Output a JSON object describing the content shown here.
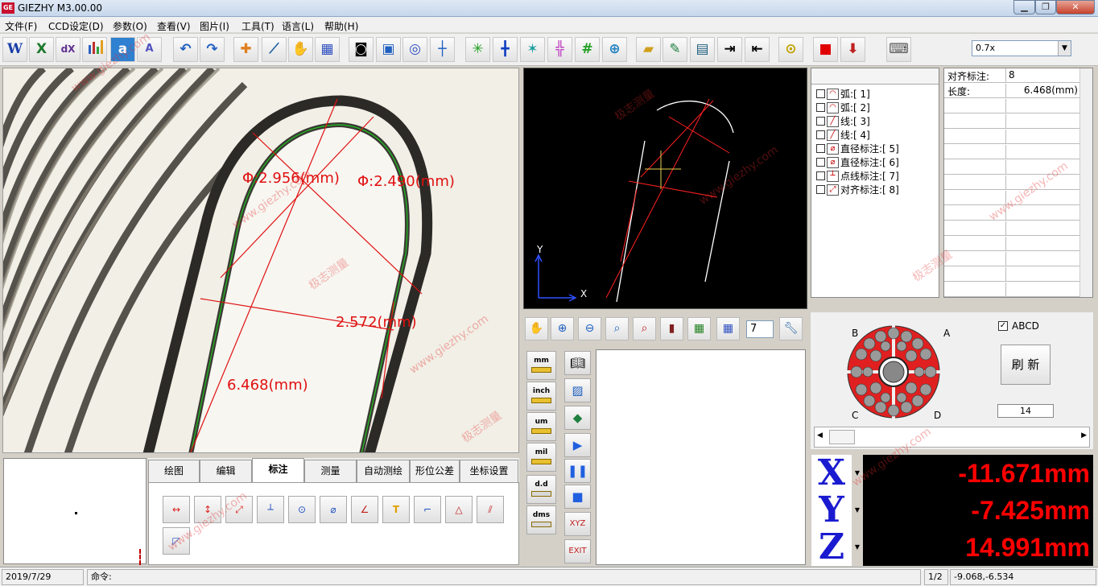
{
  "window": {
    "title": "GIEZHY M3.00.00",
    "icon_text": "GE"
  },
  "menu": [
    "文件(F)",
    "CCD设定(D)",
    "参数(O)",
    "查看(V)",
    "图片(I)",
    "工具(T)",
    "语言(L)",
    "帮助(H)"
  ],
  "toolbar": {
    "zoom": "0.7x"
  },
  "camera": {
    "labels": {
      "dia1": "Φ:2.956(mm)",
      "dia2": "Φ:2.490(mm)",
      "width": "2.572(mm)",
      "length": "6.468(mm)"
    }
  },
  "cad": {
    "axis_y": "Y",
    "axis_x": "X"
  },
  "objects": [
    {
      "label": "弧:[ 1]",
      "icon": "arc-icon"
    },
    {
      "label": "弧:[ 2]",
      "icon": "arc-icon"
    },
    {
      "label": "线:[ 3]",
      "icon": "line-icon"
    },
    {
      "label": "线:[ 4]",
      "icon": "line-icon"
    },
    {
      "label": "直径标注:[ 5]",
      "icon": "diameter-icon"
    },
    {
      "label": "直径标注:[ 6]",
      "icon": "diameter-icon"
    },
    {
      "label": "点线标注:[ 7]",
      "icon": "point-line-icon"
    },
    {
      "label": "对齐标注:[ 8]",
      "icon": "aligned-dim-icon"
    }
  ],
  "properties": [
    {
      "key": "对齐标注:",
      "value": "8"
    },
    {
      "key": "长度:",
      "value": "6.468(mm)"
    }
  ],
  "view_toolbar": {
    "layer": "7"
  },
  "units": [
    {
      "label": "mm"
    },
    {
      "label": "inch"
    },
    {
      "label": "um"
    },
    {
      "label": "mil"
    },
    {
      "label": "d.d"
    },
    {
      "label": "dms"
    }
  ],
  "tabs": [
    {
      "label": "绘图"
    },
    {
      "label": "编辑"
    },
    {
      "label": "标注"
    },
    {
      "label": "测量"
    },
    {
      "label": "自动测绘"
    },
    {
      "label": "形位公差"
    },
    {
      "label": "坐标设置"
    }
  ],
  "active_tab": "标注",
  "fiber": {
    "quad_labels": {
      "a": "A",
      "b": "B",
      "c": "C",
      "d": "D"
    },
    "abcd_label": "ABCD",
    "abcd_checked": true,
    "refresh_label": "刷 新",
    "count": "14"
  },
  "readouts": {
    "x": {
      "axis": "X",
      "value": "-11.671mm"
    },
    "y": {
      "axis": "Y",
      "value": "-7.425mm"
    },
    "z": {
      "axis": "Z",
      "value": "14.991mm"
    }
  },
  "status": {
    "date": "2019/7/29",
    "command_label": "命令:",
    "page": "1/2",
    "cursor": "-9.068,-6.534"
  },
  "watermark": {
    "text": "www.giezhy.com",
    "text_cn": "极志测量"
  },
  "colors": {
    "measure_red": "#e01010",
    "axis_blue": "#1a1ad0",
    "readout_bg": "#000000"
  }
}
